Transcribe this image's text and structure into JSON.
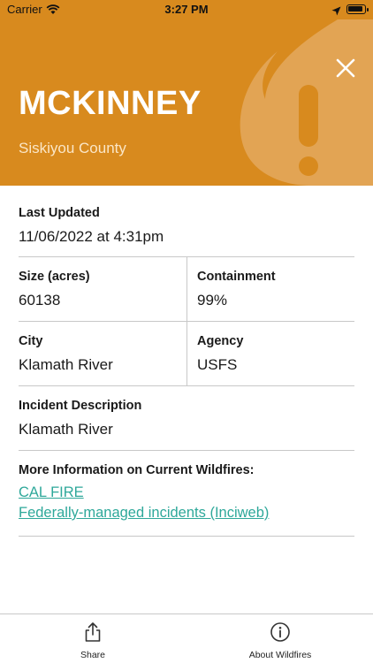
{
  "status_bar": {
    "carrier": "Carrier",
    "time": "3:27 PM"
  },
  "header": {
    "title": "MCKINNEY",
    "subtitle": "Siskiyou County",
    "background_color": "#d88a1e"
  },
  "details": {
    "last_updated": {
      "label": "Last Updated",
      "value": "11/06/2022 at 4:31pm"
    },
    "size": {
      "label": "Size (acres)",
      "value": "60138"
    },
    "containment": {
      "label": "Containment",
      "value": "99%"
    },
    "city": {
      "label": "City",
      "value": "Klamath River"
    },
    "agency": {
      "label": "Agency",
      "value": "USFS"
    },
    "description": {
      "label": "Incident Description",
      "value": "Klamath River"
    }
  },
  "more_info": {
    "label": "More Information on Current Wildfires:",
    "links": [
      "CAL FIRE",
      "Federally-managed incidents (Inciweb)"
    ],
    "link_color": "#2ea89a"
  },
  "tab_bar": {
    "share_label": "Share",
    "about_label": "About Wildfires"
  }
}
